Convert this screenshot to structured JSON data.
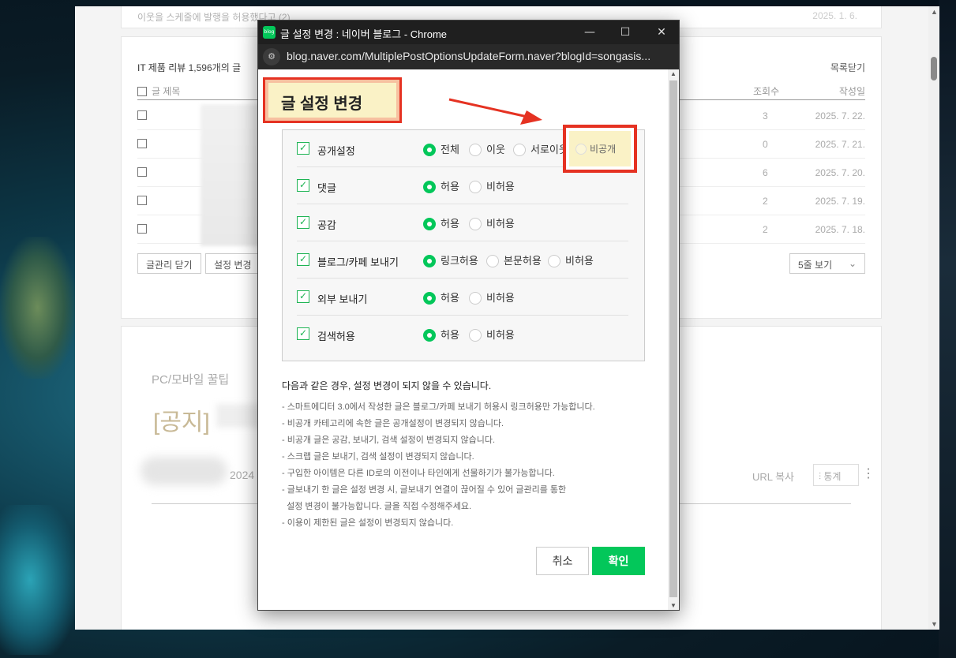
{
  "background_page": {
    "top_note": "이웃을 스케줄에 발행을 허용했다고 (2)",
    "top_date": "2025. 1. 6.",
    "list_category": "IT 제품 리뷰",
    "list_count": "1,596개의 글",
    "list_close": "목록닫기",
    "col_title": "글 제목",
    "col_views": "조회수",
    "col_date": "작성일",
    "rows": [
      {
        "views": "3",
        "date": "2025. 7. 22."
      },
      {
        "views": "0",
        "date": "2025. 7. 21."
      },
      {
        "views": "6",
        "date": "2025. 7. 20."
      },
      {
        "views": "2",
        "date": "2025. 7. 19."
      },
      {
        "views": "2",
        "date": "2025. 7. 18."
      }
    ],
    "manage_close_btn": "글관리 닫기",
    "setting_change_btn": "설정 변경",
    "view_count_select": "5줄 보기",
    "post_category": "PC/모바일 꿀팁",
    "post_title": "[공지]",
    "post_year": "2024",
    "url_copy": "URL 복사",
    "stats_btn": "통계"
  },
  "popup": {
    "window_title": "글 설정 변경 : 네이버 블로그 - Chrome",
    "app_icon_text": "blog",
    "url": "blog.naver.com/MultiplePostOptionsUpdateForm.naver?blogId=songasis...",
    "dialog_title": "글 설정 변경",
    "options": [
      {
        "label": "공개설정",
        "choices": [
          "전체",
          "이웃",
          "서로이웃",
          "비공개"
        ],
        "selected": 0
      },
      {
        "label": "댓글",
        "choices": [
          "허용",
          "비허용"
        ],
        "selected": 0
      },
      {
        "label": "공감",
        "choices": [
          "허용",
          "비허용"
        ],
        "selected": 0
      },
      {
        "label": "블로그/카페 보내기",
        "choices": [
          "링크허용",
          "본문허용",
          "비허용"
        ],
        "selected": 0
      },
      {
        "label": "외부 보내기",
        "choices": [
          "허용",
          "비허용"
        ],
        "selected": 0
      },
      {
        "label": "검색허용",
        "choices": [
          "허용",
          "비허용"
        ],
        "selected": 0
      }
    ],
    "notice_title": "다음과 같은 경우, 설정 변경이 되지 않을 수 있습니다.",
    "notices": [
      "- 스마트에디터 3.0에서 작성한 글은 블로그/카페 보내기 허용시 링크허용만 가능합니다.",
      "- 비공개 카테고리에 속한 글은 공개설정이 변경되지 않습니다.",
      "- 비공개 글은 공감, 보내기, 검색 설정이 변경되지 않습니다.",
      "- 스크랩 글은 보내기, 검색 설정이 변경되지 않습니다.",
      "- 구입한 아이템은 다른 ID로의 이전이나 타인에게 선물하기가 불가능합니다.",
      "- 글보내기 한 글은 설정 변경 시, 글보내기 연결이 끊어질 수 있어 글관리를 통한",
      "  설정 변경이 불가능합니다. 글을 직접 수정해주세요.",
      "- 이용이 제한된 글은 설정이 변경되지 않습니다."
    ],
    "cancel_label": "취소",
    "confirm_label": "확인"
  },
  "colors": {
    "naver_green": "#03c75a",
    "highlight_red": "#e53222",
    "highlight_fill": "#faf2c6"
  }
}
